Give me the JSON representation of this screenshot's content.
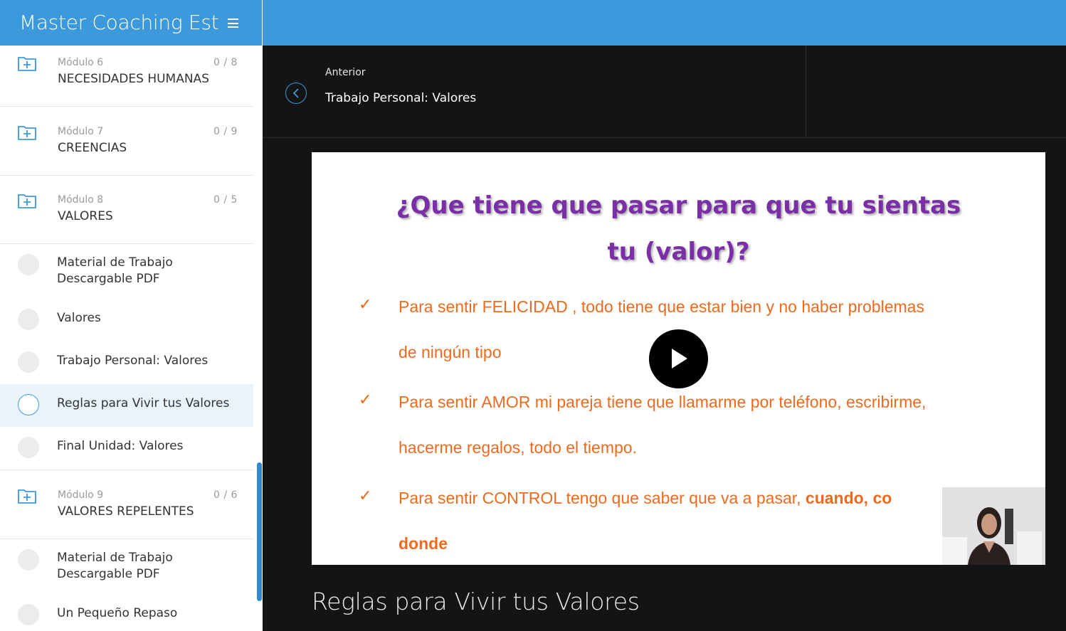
{
  "app": {
    "title": "Master Coaching Estratégico",
    "menu_icon": "hamburger-icon"
  },
  "sidebar": {
    "modules": [
      {
        "number_label": "Módulo 6",
        "name": "NECESIDADES HUMANAS",
        "progress": "0 / 8",
        "icon": "folder-plus-icon"
      },
      {
        "number_label": "Módulo 7",
        "name": "CREENCIAS",
        "progress": "0 / 9",
        "icon": "folder-plus-icon"
      },
      {
        "number_label": "Módulo 8",
        "name": "VALORES",
        "progress": "0 / 5",
        "icon": "folder-plus-icon"
      },
      {
        "number_label": "Módulo 9",
        "name": "VALORES REPELENTES",
        "progress": "0 / 6",
        "icon": "folder-plus-icon"
      }
    ],
    "module8_lessons": [
      {
        "label_line1": "Material de Trabajo",
        "label_line2": "Descargable PDF"
      },
      {
        "label": "Valores"
      },
      {
        "label": "Trabajo Personal: Valores"
      },
      {
        "label": "Reglas para Vivir tus Valores",
        "active": true
      },
      {
        "label": "Final Unidad: Valores"
      }
    ],
    "module9_lessons": [
      {
        "label_line1": "Material de Trabajo",
        "label_line2": "Descargable PDF"
      },
      {
        "label": "Un Pequeño Repaso"
      }
    ]
  },
  "header": {
    "previous_label": "Anterior",
    "previous_title": "Trabajo Personal: Valores",
    "back_icon": "chevron-left-icon"
  },
  "video": {
    "slide_question_line1": "¿Que tiene que pasar para que tu sientas",
    "slide_question_line2": "tu (valor)?",
    "bullets": [
      {
        "line1": "Para sentir FELICIDAD ,  todo tiene que estar bien y no haber problemas",
        "line2": "de ningún tipo"
      },
      {
        "line1": "Para sentir AMOR mi pareja tiene que llamarme por teléfono, escribirme,",
        "line2": "hacerme regalos, todo el tiempo."
      },
      {
        "line1_plain": "Para sentir CONTROL tengo que saber que va a pasar,",
        "line1_bold": "cuando, co",
        "line2_bold": "donde"
      }
    ],
    "check_glyph": "✓",
    "play_icon": "play-icon",
    "webcam": "presenter-webcam-thumbnail"
  },
  "lesson_title": "Reglas para Vivir tus Valores",
  "colors": {
    "brand_blue": "#3b99dc",
    "slide_purple": "#7b2fa6",
    "slide_orange": "#ee6a1e",
    "dark_bg": "#141414",
    "active_row": "#e8f3fc"
  }
}
